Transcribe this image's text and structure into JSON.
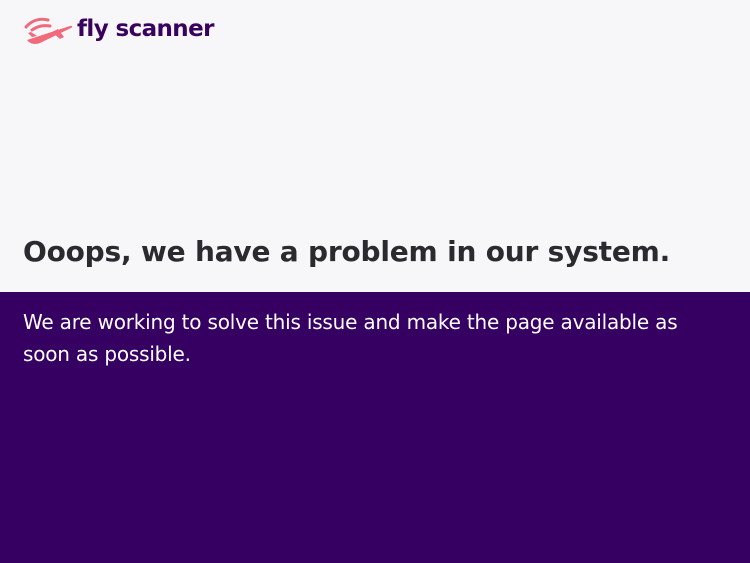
{
  "brand": {
    "name": "fly scanner",
    "accent_color": "#f06a7c",
    "text_color": "#3a005f",
    "icon": "plane-signal-icon"
  },
  "error": {
    "title": "Ooops, we have a problem in our system.",
    "message": "We are working to solve this issue and make the page available as soon as possible."
  },
  "colors": {
    "page_background": "#f7f7f9",
    "message_background": "#350062",
    "title_text": "#2a2a2f",
    "message_text": "#ffffff"
  }
}
